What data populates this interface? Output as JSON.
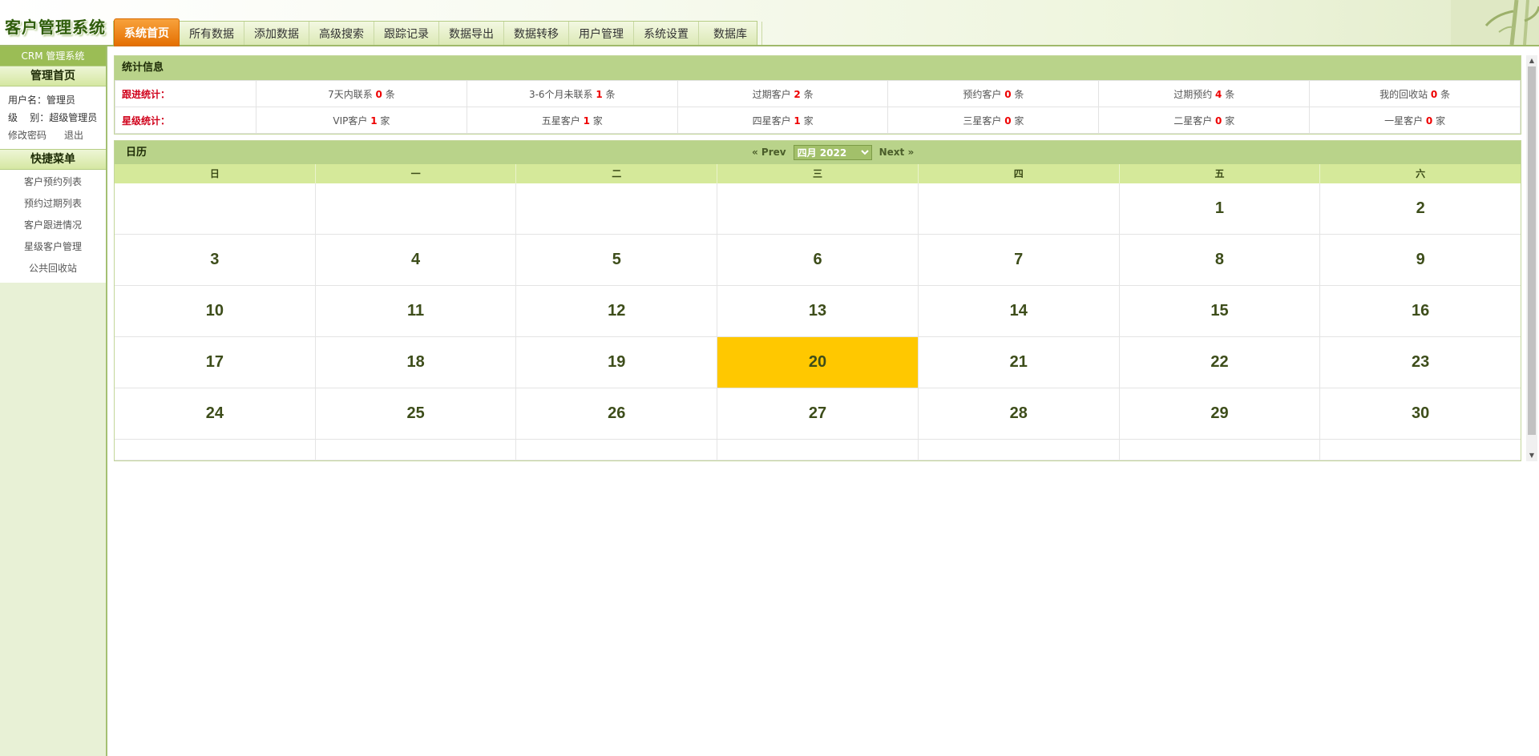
{
  "header": {
    "logo": "客户管理系统",
    "nav": [
      "系统首页",
      "所有数据",
      "添加数据",
      "高级搜索",
      "跟踪记录",
      "数据导出",
      "数据转移",
      "用户管理",
      "系统设置",
      "数据库"
    ],
    "active_nav": "系统首页"
  },
  "sidebar": {
    "title": "CRM 管理系统",
    "home_section": "管理首页",
    "user_line": "用户名：管理员",
    "level_line": "级    别：超级管理员",
    "change_password": "修改密码",
    "logout": "退出",
    "quick_section": "快捷菜单",
    "quick_items": [
      "客户预约列表",
      "预约过期列表",
      "客户跟进情况",
      "星级客户管理",
      "公共回收站"
    ]
  },
  "stats": {
    "title": "统计信息",
    "row1": {
      "label": "跟进统计：",
      "cells": [
        {
          "pre": "7天内联系 ",
          "num": "0",
          "post": " 条"
        },
        {
          "pre": "3-6个月未联系 ",
          "num": "1",
          "post": " 条"
        },
        {
          "pre": "过期客户 ",
          "num": "2",
          "post": " 条"
        },
        {
          "pre": "预约客户 ",
          "num": "0",
          "post": " 条"
        },
        {
          "pre": "过期预约 ",
          "num": "4",
          "post": " 条"
        },
        {
          "pre": "我的回收站 ",
          "num": "0",
          "post": " 条"
        }
      ]
    },
    "row2": {
      "label": "星级统计：",
      "cells": [
        {
          "pre": "VIP客户 ",
          "num": "1",
          "post": " 家"
        },
        {
          "pre": "五星客户 ",
          "num": "1",
          "post": " 家"
        },
        {
          "pre": "四星客户 ",
          "num": "1",
          "post": " 家"
        },
        {
          "pre": "三星客户 ",
          "num": "0",
          "post": " 家"
        },
        {
          "pre": "二星客户 ",
          "num": "0",
          "post": " 家"
        },
        {
          "pre": "一星客户 ",
          "num": "0",
          "post": " 家"
        }
      ]
    }
  },
  "calendar": {
    "title": "日历",
    "prev": "« Prev",
    "next": "Next »",
    "month_select": "四月 2022",
    "weekdays": [
      "日",
      "一",
      "二",
      "三",
      "四",
      "五",
      "六"
    ],
    "weeks": [
      [
        "",
        "",
        "",
        "",
        "",
        "1",
        "2"
      ],
      [
        "3",
        "4",
        "5",
        "6",
        "7",
        "8",
        "9"
      ],
      [
        "10",
        "11",
        "12",
        "13",
        "14",
        "15",
        "16"
      ],
      [
        "17",
        "18",
        "19",
        "20",
        "21",
        "22",
        "23"
      ],
      [
        "24",
        "25",
        "26",
        "27",
        "28",
        "29",
        "30"
      ],
      [
        "",
        "",
        "",
        "",
        "",
        "",
        ""
      ]
    ],
    "today": "20",
    "today_color": "#ffc800"
  },
  "colors": {
    "accent_orange": "#e46f02",
    "header_green": "#b9d38a",
    "sidebar_bg": "#e8f1d6"
  }
}
